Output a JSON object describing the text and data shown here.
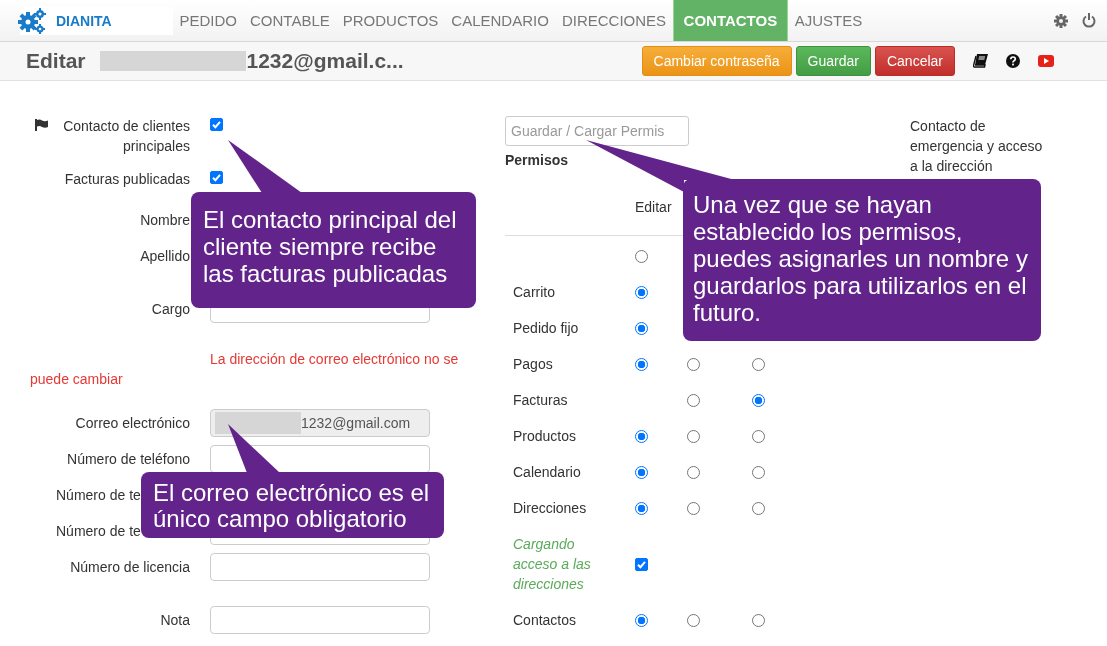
{
  "nav": {
    "brand": "DIANITA",
    "tabs": [
      {
        "label": "PEDIDO",
        "selected": false
      },
      {
        "label": "CONTABLE",
        "selected": false
      },
      {
        "label": "PRODUCTOS",
        "selected": false
      },
      {
        "label": "CALENDARIO",
        "selected": false
      },
      {
        "label": "DIRECCIONES",
        "selected": false
      },
      {
        "label": "CONTACTOS",
        "selected": true
      },
      {
        "label": "AJUSTES",
        "selected": false
      }
    ]
  },
  "header": {
    "title": "Editar",
    "title_value": "1232@gmail.c...",
    "buttons": [
      {
        "label": "Cambiar contraseña",
        "kind": "warning"
      },
      {
        "label": "Guardar",
        "kind": "success"
      },
      {
        "label": "Cancelar",
        "kind": "danger"
      }
    ]
  },
  "form": {
    "rows": [
      {
        "kind": "check",
        "label": "Contacto de clientes principales",
        "flag": true,
        "checked": true
      },
      {
        "kind": "check",
        "label": "Facturas publicadas",
        "flag": false,
        "checked": true
      },
      {
        "kind": "label",
        "label": "Nombre"
      },
      {
        "kind": "label",
        "label": "Apellido"
      },
      {
        "kind": "text",
        "label": "Cargo"
      },
      {
        "kind": "error",
        "text": "La dirección de correo electrónico no se puede cambiar"
      },
      {
        "kind": "text",
        "label": "Correo electrónico",
        "value": "1232@gmail.com",
        "disabled": true
      },
      {
        "kind": "text",
        "label": "Número de teléfono"
      },
      {
        "kind": "label",
        "label": "Número de te",
        "cut": true
      },
      {
        "kind": "text",
        "label": "Número de te",
        "cut": true
      },
      {
        "kind": "text",
        "label": "Número de licencia"
      },
      {
        "kind": "text",
        "label": "Nota"
      }
    ]
  },
  "permissions": {
    "save_field": {
      "placeholder": "Guardar / Cargar Permis"
    },
    "title": "Permisos",
    "note": "Contacto de emergencia y acceso a la dirección",
    "columns": [
      "Editar"
    ],
    "rows": [
      {
        "kind": "radio",
        "options": [
          {
            "selected": false
          }
        ]
      },
      {
        "kind": "radio",
        "label": "Carrito",
        "options": [
          {
            "selected": true
          }
        ]
      },
      {
        "kind": "radio",
        "label": "Pedido fijo",
        "options": [
          {
            "selected": true
          }
        ]
      },
      {
        "kind": "radio",
        "label": "Pagos",
        "options": [
          {
            "selected": true
          },
          {
            "selected": false
          },
          {
            "selected": false
          }
        ]
      },
      {
        "kind": "radio",
        "label": "Facturas",
        "options": [
          {
            "blank": true
          },
          {
            "selected": false
          },
          {
            "selected": true
          }
        ]
      },
      {
        "kind": "radio",
        "label": "Productos",
        "options": [
          {
            "selected": true
          },
          {
            "selected": false
          },
          {
            "selected": false
          }
        ]
      },
      {
        "kind": "radio",
        "label": "Calendario",
        "options": [
          {
            "selected": true
          },
          {
            "selected": false
          },
          {
            "selected": false
          }
        ]
      },
      {
        "kind": "radio",
        "label": "Direcciones",
        "options": [
          {
            "selected": true
          },
          {
            "selected": false
          },
          {
            "selected": false
          }
        ]
      },
      {
        "kind": "check",
        "label": "Cargando acceso a las direcciones",
        "checked": true
      },
      {
        "kind": "radio",
        "label": "Contactos",
        "options": [
          {
            "selected": true
          },
          {
            "selected": false
          },
          {
            "selected": false
          }
        ]
      }
    ]
  },
  "callouts": [
    {
      "text": "El contacto principal del cliente siempre recibe las facturas publicadas"
    },
    {
      "text": "Una vez que se hayan establecido los permisos, puedes asignarles un nombre y guardarlos para utilizarlos en el futuro."
    },
    {
      "text": "El correo electrónico es el único campo obligatorio"
    }
  ]
}
